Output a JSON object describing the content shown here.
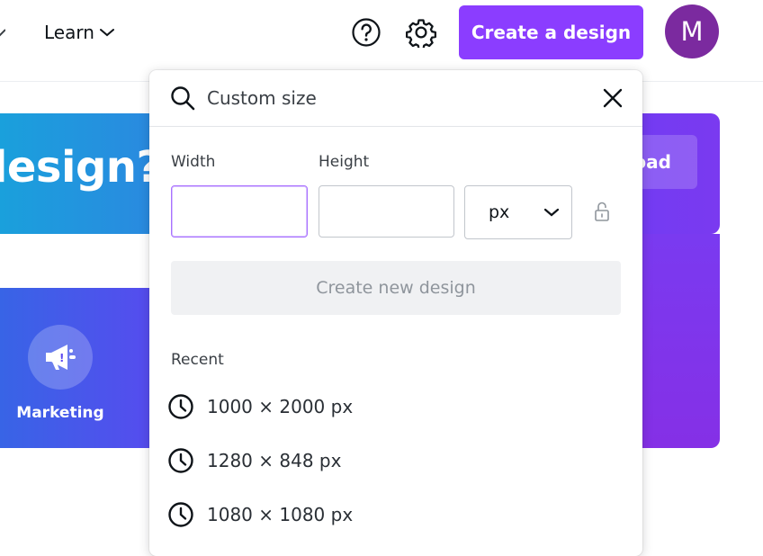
{
  "header": {
    "learn_label": "Learn",
    "create_button_label": "Create a design",
    "avatar_initial": "M"
  },
  "background": {
    "banner_text": "design?",
    "banner_button_label": "Upload",
    "category_label": "Marketing"
  },
  "popover": {
    "search": {
      "placeholder": "Custom size",
      "value": ""
    },
    "width_label": "Width",
    "height_label": "Height",
    "width_value": "",
    "height_value": "",
    "unit_selected": "px",
    "create_new_label": "Create new design",
    "recent_label": "Recent",
    "recent_items": [
      {
        "label": "1000 × 2000 px"
      },
      {
        "label": "1280 × 848 px"
      },
      {
        "label": "1080 × 1080 px"
      }
    ]
  },
  "colors": {
    "accent": "#8b3dff",
    "avatar": "#7b2a9f",
    "focus_border": "#a971ff"
  },
  "icons": [
    "chevron-down-icon",
    "help-icon",
    "gear-icon",
    "search-icon",
    "close-icon",
    "lock-icon",
    "clock-icon",
    "megaphone-icon"
  ]
}
